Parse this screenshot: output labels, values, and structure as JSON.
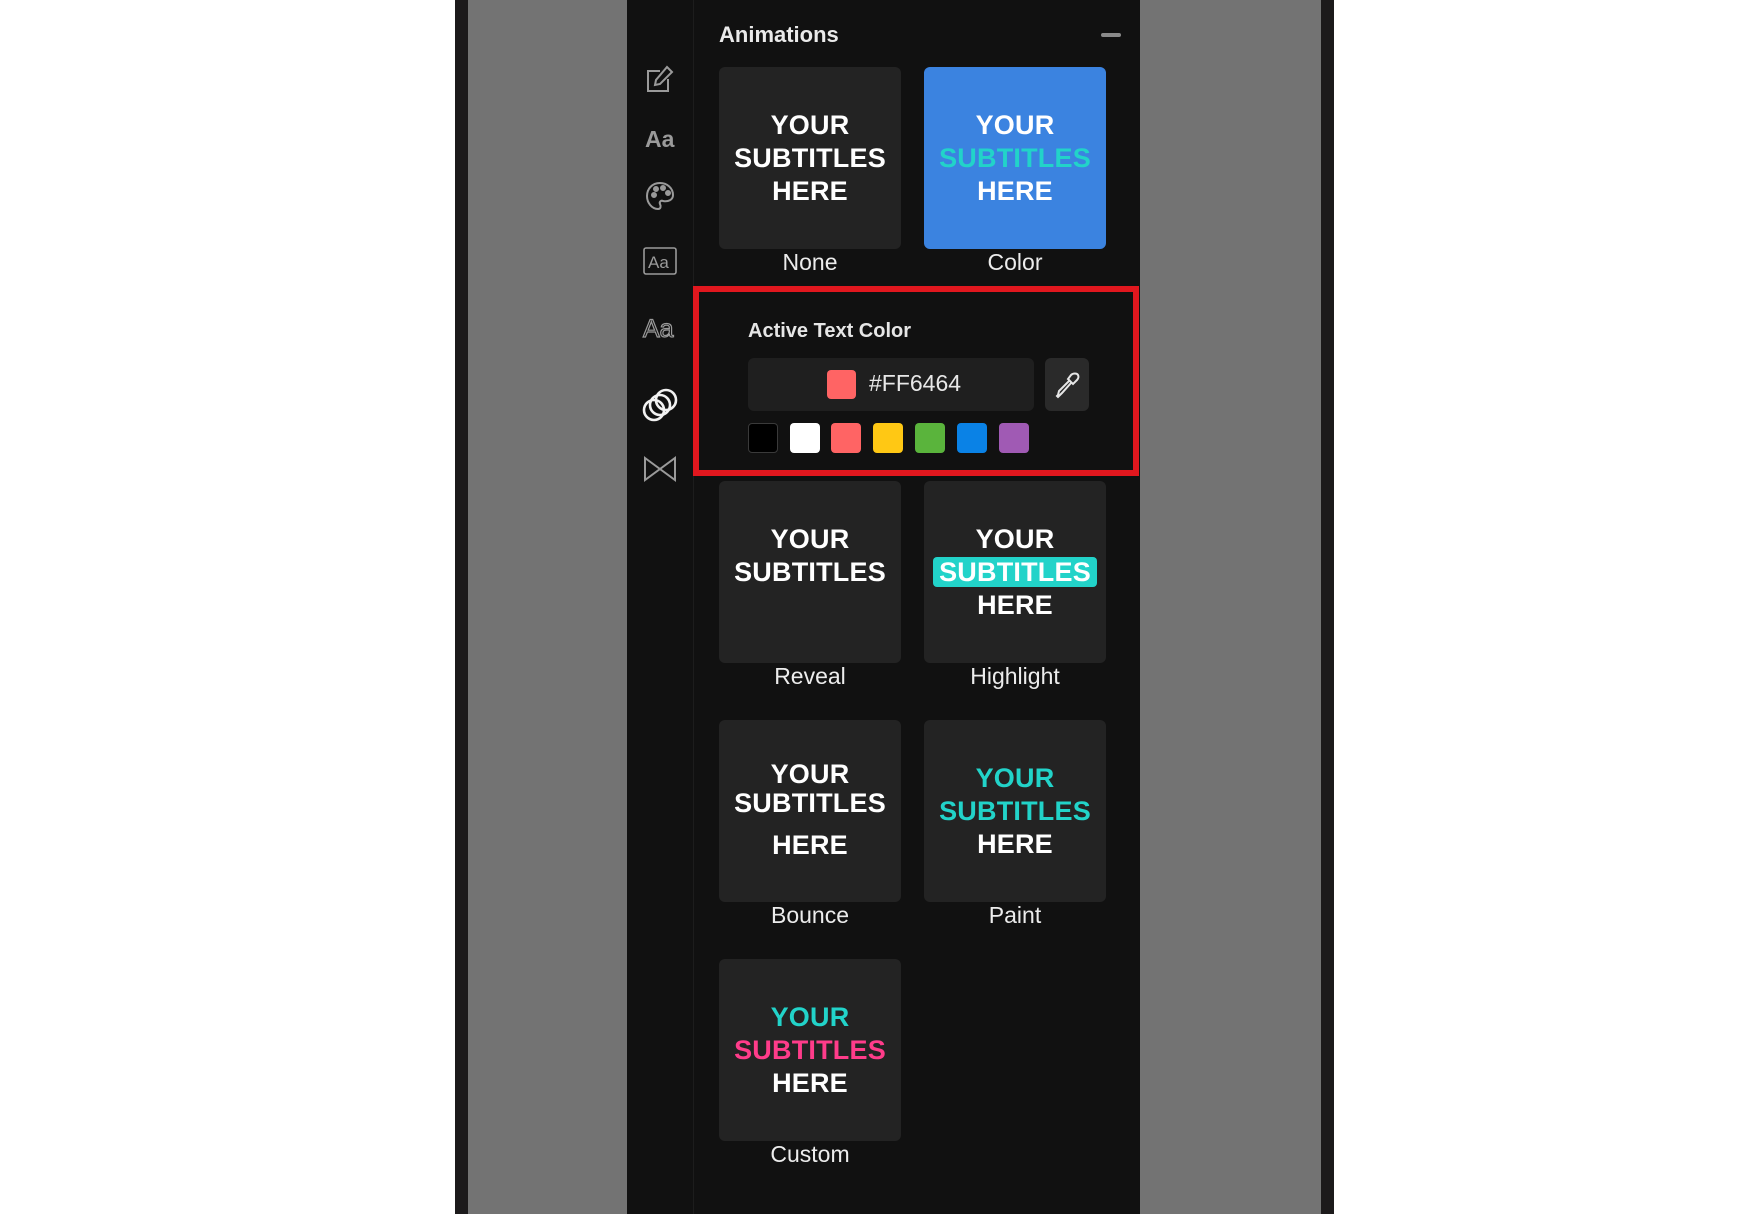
{
  "section": {
    "title": "Animations"
  },
  "colors": {
    "accent": "#3b83e0",
    "highlight": "#e1171e",
    "teal": "#22d3c9",
    "pink": "#ff3c8a"
  },
  "rail": [
    {
      "name": "edit-icon"
    },
    {
      "name": "font-icon"
    },
    {
      "name": "palette-icon"
    },
    {
      "name": "text-box-icon"
    },
    {
      "name": "text-outline-icon"
    },
    {
      "name": "animations-icon",
      "active": true
    },
    {
      "name": "transitions-icon"
    }
  ],
  "animations": [
    {
      "id": "none",
      "label": "None",
      "preview": [
        "YOUR",
        "SUBTITLES",
        "HERE"
      ]
    },
    {
      "id": "color",
      "label": "Color",
      "selected": true,
      "preview": [
        "YOUR",
        "SUBTITLES",
        "HERE"
      ]
    },
    {
      "id": "reveal",
      "label": "Reveal",
      "preview": [
        "YOUR",
        "SUBTITLES"
      ]
    },
    {
      "id": "highlight",
      "label": "Highlight",
      "preview": [
        "YOUR",
        "SUBTITLES",
        "HERE"
      ]
    },
    {
      "id": "bounce",
      "label": "Bounce",
      "preview": [
        "YOUR",
        "SUBTITLES",
        "HERE"
      ]
    },
    {
      "id": "paint",
      "label": "Paint",
      "preview": [
        "YOUR",
        "SUBTITLES",
        "HERE"
      ]
    },
    {
      "id": "custom",
      "label": "Custom",
      "preview": [
        "YOUR",
        "SUBTITLES",
        "HERE"
      ]
    }
  ],
  "active_color": {
    "title": "Active Text Color",
    "hex": "#FF6464",
    "swatches": [
      "#000000",
      "#ffffff",
      "#ff6464",
      "#ffc814",
      "#5ab43c",
      "#0a82e6",
      "#a05ab4"
    ]
  }
}
